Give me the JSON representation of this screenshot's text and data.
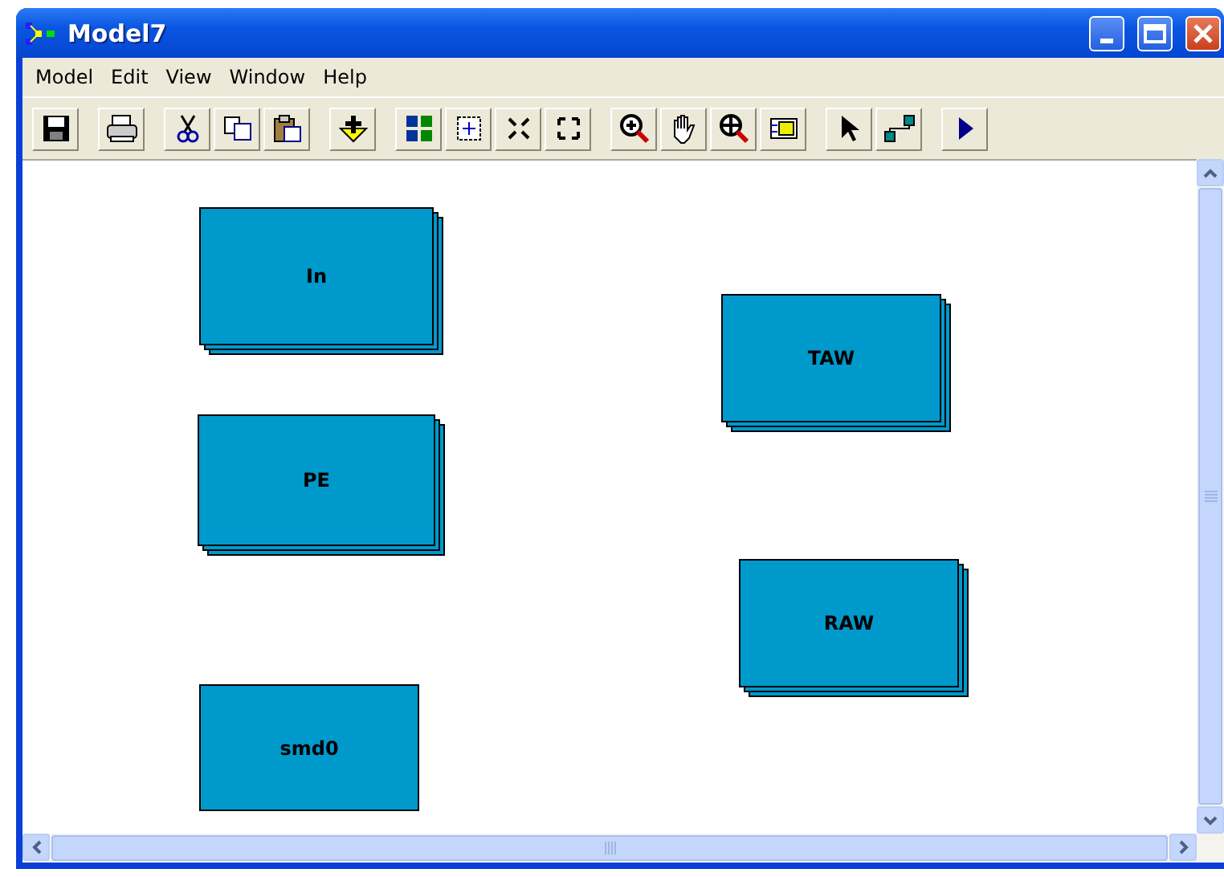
{
  "window": {
    "title": "Model7"
  },
  "menu": [
    "Model",
    "Edit",
    "View",
    "Window",
    "Help"
  ],
  "nodes": [
    {
      "label": "In",
      "stacked": true
    },
    {
      "label": "PE",
      "stacked": true
    },
    {
      "label": "smd0",
      "stacked": false
    },
    {
      "label": "TAW",
      "stacked": true
    },
    {
      "label": "RAW",
      "stacked": true
    }
  ]
}
